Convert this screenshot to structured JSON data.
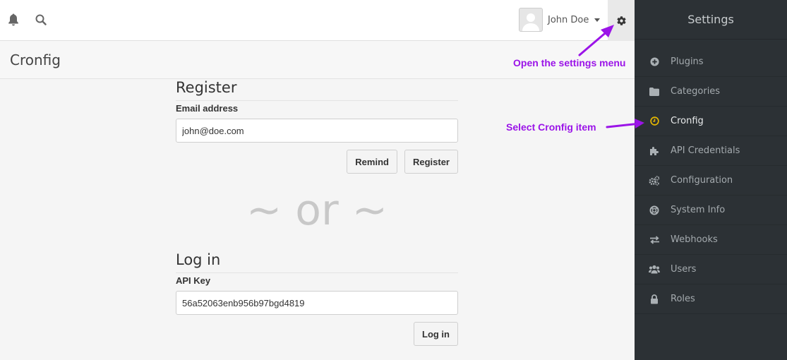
{
  "topbar": {
    "notifications_icon": "bell-icon",
    "search_icon": "search-icon",
    "user": {
      "name": "John Doe",
      "avatar_icon": "user-avatar-icon"
    },
    "settings_icon": "gear-icon"
  },
  "page": {
    "title": "Cronfig"
  },
  "register": {
    "title": "Register",
    "email_label": "Email address",
    "email_value": "john@doe.com",
    "remind_label": "Remind",
    "register_label": "Register"
  },
  "separator": "~ or ~",
  "login": {
    "title": "Log in",
    "api_key_label": "API Key",
    "api_key_value": "56a52063enb956b97bgd4819",
    "login_label": "Log in"
  },
  "sidebar": {
    "title": "Settings",
    "items": [
      {
        "label": "Plugins",
        "icon": "plus-circle-icon"
      },
      {
        "label": "Categories",
        "icon": "folder-icon"
      },
      {
        "label": "Cronfig",
        "icon": "clock-icon",
        "active": true
      },
      {
        "label": "API Credentials",
        "icon": "puzzle-icon"
      },
      {
        "label": "Configuration",
        "icon": "gears-icon"
      },
      {
        "label": "System Info",
        "icon": "life-ring-icon"
      },
      {
        "label": "Webhooks",
        "icon": "exchange-icon"
      },
      {
        "label": "Users",
        "icon": "users-icon"
      },
      {
        "label": "Roles",
        "icon": "lock-icon"
      }
    ]
  },
  "annotations": {
    "settings_menu": "Open the settings menu",
    "cronfig_item": "Select Cronfig item",
    "color": "#9b14e8"
  },
  "colors": {
    "sidebar_bg": "#2c3135",
    "active_icon": "#e6b800",
    "annotation": "#9b14e8"
  }
}
